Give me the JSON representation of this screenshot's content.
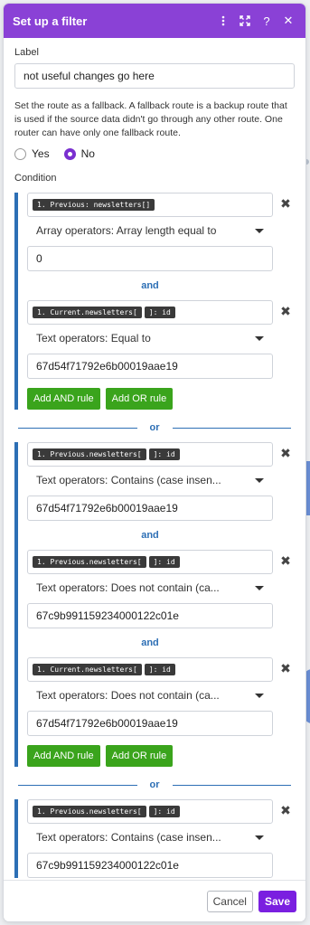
{
  "header": {
    "title": "Set up a filter",
    "icons": [
      "more-vertical-icon",
      "expand-icon",
      "help-icon",
      "close-icon"
    ],
    "help_glyph": "?",
    "close_glyph": "✕"
  },
  "label_field": {
    "label": "Label",
    "value": "not useful changes go here"
  },
  "fallback": {
    "help": "Set the route as a fallback. A fallback route is a backup route that is used if the source data didn't go through any other route. One router can have only one fallback route.",
    "yes": "Yes",
    "no": "No",
    "selected": "No"
  },
  "condition_label": "Condition",
  "groups": [
    {
      "rules": [
        {
          "token": "1. Previous: newsletters[]",
          "operator": "Array operators: Array length equal to",
          "value": "0"
        },
        {
          "token_a": "1. Current.newsletters[",
          "token_b": "]: id",
          "operator": "Text operators: Equal to",
          "value": "67d54f71792e6b00019aae19"
        }
      ],
      "and_label": "and",
      "add_and": "Add AND rule",
      "add_or": "Add OR rule"
    },
    {
      "rules": [
        {
          "token_a": "1. Previous.newsletters[",
          "token_b": "]: id",
          "operator": "Text operators: Contains (case insen...",
          "value": "67d54f71792e6b00019aae19"
        },
        {
          "token_a": "1. Previous.newsletters[",
          "token_b": "]: id",
          "operator": "Text operators: Does not contain (ca...",
          "value": "67c9b991159234000122c01e"
        },
        {
          "token_a": "1. Current.newsletters[",
          "token_b": "]: id",
          "operator": "Text operators: Does not contain (ca...",
          "value": "67d54f71792e6b00019aae19"
        }
      ],
      "and_label": "and",
      "add_and": "Add AND rule",
      "add_or": "Add OR rule"
    },
    {
      "rules": [
        {
          "token_a": "1. Previous.newsletters[",
          "token_b": "]: id",
          "operator": "Text operators: Contains (case insen...",
          "value": "67c9b991159234000122c01e"
        }
      ]
    }
  ],
  "or_label": "or",
  "remove_glyph": "✖",
  "footer": {
    "cancel": "Cancel",
    "save": "Save"
  },
  "colors": {
    "header": "#8a41d6",
    "accent_blue": "#2d6fb5",
    "green": "#3aa41c",
    "save": "#7a1fe0"
  }
}
